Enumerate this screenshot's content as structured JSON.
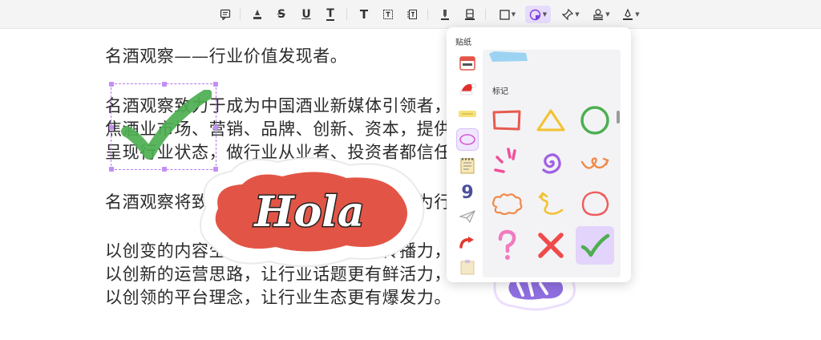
{
  "toolbar": {
    "active_tool": "sticker",
    "tools": [
      {
        "name": "note-icon",
        "glyph": ""
      },
      {
        "name": "highlight-icon",
        "glyph": "A"
      },
      {
        "name": "strikethrough-icon",
        "glyph": "S"
      },
      {
        "name": "underline-icon",
        "glyph": "U"
      },
      {
        "name": "squiggly-icon",
        "glyph": "T"
      },
      {
        "name": "text-icon",
        "glyph": "T"
      },
      {
        "name": "textbox-icon",
        "glyph": "T"
      },
      {
        "name": "callout-icon",
        "glyph": "T"
      }
    ]
  },
  "document": {
    "paragraphs": [
      "名酒观察——行业价值发现者。",
      "名酒观察致力于成为中国酒业新媒体引领者，平台内容将聚",
      "焦酒业市场、营销、品牌、创新、资本，提供行业财经资讯，",
      "呈现行业状态，做行业从业者、投资者都信任的内容原创平台。",
      "名酒观察将致力于成为行业价值发现者，为行业赋能。",
      "以创变的内容生态，让行业价值更有传播力，",
      "以创新的运营思路，让行业话题更有鲜活力，",
      "以创领的平台理念，让行业生态更有爆发力。"
    ]
  },
  "stickers_on_page": [
    {
      "name": "checkmark-sticker",
      "color": "#4caf50"
    },
    {
      "name": "hola-sticker",
      "text": "Hola",
      "color": "#e25546"
    },
    {
      "name": "partial-purple-sticker",
      "color": "#8f6fe0"
    }
  ],
  "panel": {
    "title": "贴纸",
    "section_label": "标记",
    "categories": [
      "calendar-sticker-icon",
      "santa-hat-sticker-icon",
      "label-sticker-icon",
      "circle-mark-sticker-icon",
      "notepad-sticker-icon",
      "number-sticker-icon",
      "paper-plane-sticker-icon",
      "arrow-sticker-icon",
      "sticky-note-sticker-icon"
    ],
    "active_category": "circle-mark-sticker-icon",
    "stickers": [
      {
        "name": "rectangle-mark-icon",
        "color": "#e85a4f"
      },
      {
        "name": "triangle-mark-icon",
        "color": "#f2c230"
      },
      {
        "name": "circle-mark-icon",
        "color": "#4caf50"
      },
      {
        "name": "burst-lines-icon",
        "color": "#f04f9a"
      },
      {
        "name": "spiral-icon",
        "color": "#a05fe6"
      },
      {
        "name": "curly-arrow-icon",
        "color": "#f08a4b"
      },
      {
        "name": "cloud-outline-icon",
        "color": "#f08a4b"
      },
      {
        "name": "wavy-arrow-icon",
        "color": "#f2c230"
      },
      {
        "name": "scribble-circle-icon",
        "color": "#ef5b5b"
      },
      {
        "name": "question-mark-icon",
        "color": "#f27ac0"
      },
      {
        "name": "cross-mark-icon",
        "color": "#ef4b4b"
      },
      {
        "name": "check-mark-icon",
        "color": "#4caf50"
      }
    ],
    "selected_sticker": "check-mark-icon"
  }
}
